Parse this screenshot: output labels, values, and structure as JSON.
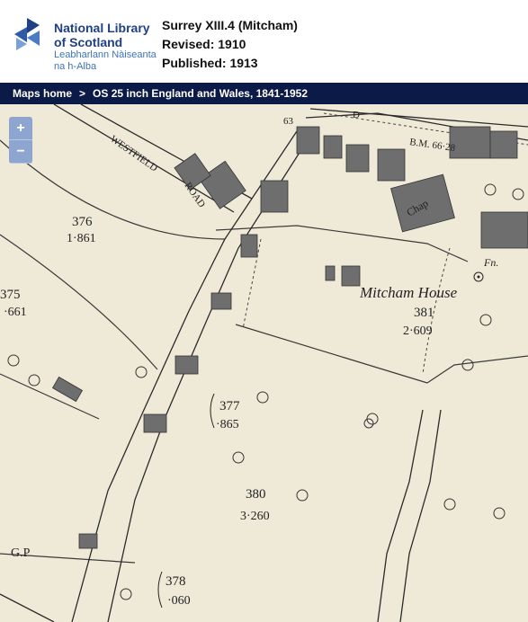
{
  "header": {
    "logo_line1": "National Library",
    "logo_line2": "of Scotland",
    "logo_line3": "Leabharlann Nàiseanta",
    "logo_line4": "na h-Alba",
    "sheet_title": "Surrey XIII.4 (Mitcham)",
    "revised": "Revised: 1910",
    "published": "Published: 1913",
    "brand_color": "#1f3f86"
  },
  "breadcrumb": {
    "home": "Maps home",
    "separator": ">",
    "current": "OS 25 inch England and Wales, 1841-1952"
  },
  "zoom": {
    "in": "+",
    "out": "−"
  },
  "map": {
    "labels": {
      "westfield": "WESTFIELD",
      "road": "ROAD",
      "bm": "B.M. 66·28",
      "chap": "Chap",
      "fn": "Fn.",
      "mitcham_house": "Mitcham House",
      "gp": "G.P",
      "n63": "63",
      "d": "D"
    },
    "parcels": [
      {
        "num": "376",
        "area": "1·861"
      },
      {
        "num": "375",
        "area": "·661"
      },
      {
        "num": "381",
        "area": "2·609"
      },
      {
        "num": "377",
        "area": "·865"
      },
      {
        "num": "380",
        "area": "3·260"
      },
      {
        "num": "378",
        "area": "·060"
      }
    ]
  }
}
